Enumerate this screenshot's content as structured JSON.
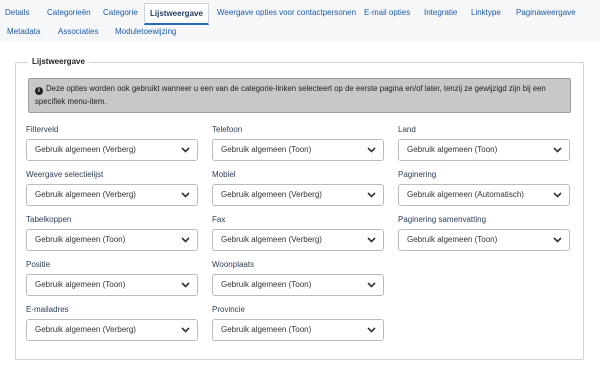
{
  "tabs": [
    {
      "label": "Details",
      "active": false
    },
    {
      "label": "Categorieën",
      "active": false
    },
    {
      "label": "Categorie",
      "active": false
    },
    {
      "label": "Lijstweergave",
      "active": true
    },
    {
      "label": "Weergave opties voor contactpersonen",
      "active": false
    },
    {
      "label": "E-mail opties",
      "active": false
    },
    {
      "label": "Integratie",
      "active": false
    },
    {
      "label": "Linktype",
      "active": false
    },
    {
      "label": "Paginaweergave",
      "active": false
    },
    {
      "label": "Metadata",
      "active": false
    },
    {
      "label": "Associaties",
      "active": false
    },
    {
      "label": "Moduletoewijzing",
      "active": false
    }
  ],
  "panel": {
    "legend": "Lijstweergave",
    "info_icon": "info-circle-icon",
    "info_text": "Deze opties worden ook gebruikt wanneer u een van de categorie-linken selecteert op de eerste pagina en/of later, tenzij ze gewijzigd zijn bij een specifiek menu-item."
  },
  "fields": {
    "col1": [
      {
        "label": "Filterveld",
        "value": "Gebruik algemeen (Verberg)"
      },
      {
        "label": "Weergave selectielijst",
        "value": "Gebruik algemeen (Verberg)"
      },
      {
        "label": "Tabelkoppen",
        "value": "Gebruik algemeen (Toon)"
      },
      {
        "label": "Positie",
        "value": "Gebruik algemeen (Toon)"
      },
      {
        "label": "E-mailadres",
        "value": "Gebruik algemeen (Verberg)"
      }
    ],
    "col2": [
      {
        "label": "Telefoon",
        "value": "Gebruik algemeen (Toon)"
      },
      {
        "label": "Mobiel",
        "value": "Gebruik algemeen (Verberg)"
      },
      {
        "label": "Fax",
        "value": "Gebruik algemeen (Verberg)"
      },
      {
        "label": "Woonplaats",
        "value": "Gebruik algemeen (Toon)"
      },
      {
        "label": "Provincie",
        "value": "Gebruik algemeen (Toon)"
      }
    ],
    "col3": [
      {
        "label": "Land",
        "value": "Gebruik algemeen (Toon)"
      },
      {
        "label": "Paginering",
        "value": "Gebruik algemeen (Automatisch)"
      },
      {
        "label": "Paginering samenvatting",
        "value": "Gebruik algemeen (Toon)"
      }
    ]
  },
  "colors": {
    "accent": "#2a69b8",
    "link": "#1f5aa6",
    "alert_bg": "#c8c8c8"
  }
}
